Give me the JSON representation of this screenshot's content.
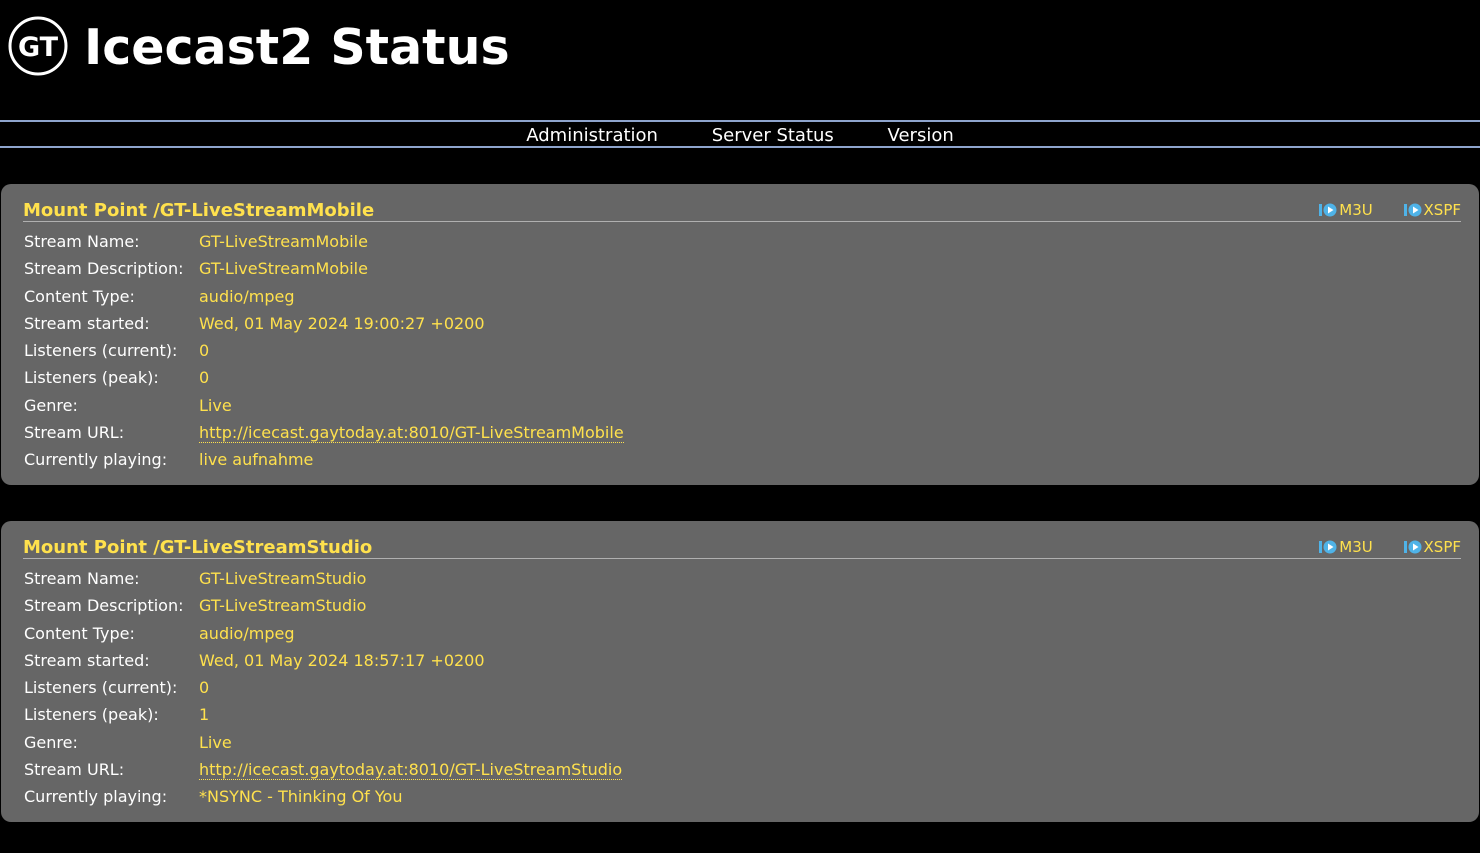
{
  "header": {
    "logo_text": "GT",
    "title": "Icecast2 Status"
  },
  "nav": [
    "Administration",
    "Server Status",
    "Version"
  ],
  "playlist_links": {
    "m3u": "M3U",
    "xspf": "XSPF"
  },
  "mounts": [
    {
      "title": "Mount Point /GT-LiveStreamMobile",
      "fields": [
        {
          "key": "Stream Name:",
          "value": "GT-LiveStreamMobile"
        },
        {
          "key": "Stream Description:",
          "value": "GT-LiveStreamMobile"
        },
        {
          "key": "Content Type:",
          "value": "audio/mpeg"
        },
        {
          "key": "Stream started:",
          "value": "Wed, 01 May 2024 19:00:27 +0200"
        },
        {
          "key": "Listeners (current):",
          "value": "0"
        },
        {
          "key": "Listeners (peak):",
          "value": "0"
        },
        {
          "key": "Genre:",
          "value": "Live"
        },
        {
          "key": "Stream URL:",
          "value": "http://icecast.gaytoday.at:8010/GT-LiveStreamMobile"
        },
        {
          "key": "Currently playing:",
          "value": "live aufnahme"
        }
      ]
    },
    {
      "title": "Mount Point /GT-LiveStreamStudio",
      "fields": [
        {
          "key": "Stream Name:",
          "value": "GT-LiveStreamStudio"
        },
        {
          "key": "Stream Description:",
          "value": "GT-LiveStreamStudio"
        },
        {
          "key": "Content Type:",
          "value": "audio/mpeg"
        },
        {
          "key": "Stream started:",
          "value": "Wed, 01 May 2024 18:57:17 +0200"
        },
        {
          "key": "Listeners (current):",
          "value": "0"
        },
        {
          "key": "Listeners (peak):",
          "value": "1"
        },
        {
          "key": "Genre:",
          "value": "Live"
        },
        {
          "key": "Stream URL:",
          "value": "http://icecast.gaytoday.at:8010/GT-LiveStreamStudio"
        },
        {
          "key": "Currently playing:",
          "value": "*NSYNC - Thinking Of You"
        }
      ]
    }
  ],
  "colors": {
    "background": "#000000",
    "panel": "#666666",
    "accent": "#ffe14d",
    "nav_rule": "#8ea4cc"
  }
}
